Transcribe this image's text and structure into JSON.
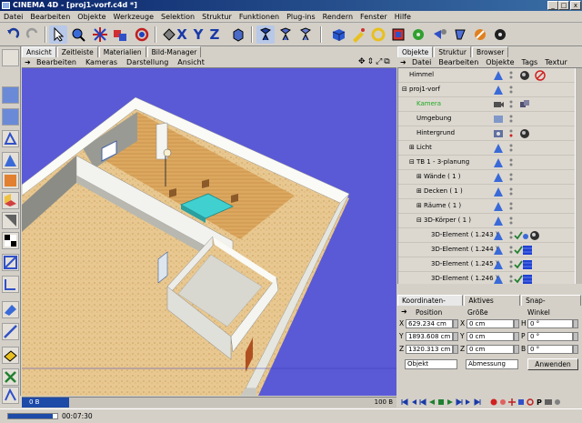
{
  "window": {
    "title": "CINEMA 4D - [proj1-vorf.c4d *]",
    "min": "_",
    "max": "□",
    "close": "x"
  },
  "menu": [
    "Datei",
    "Bearbeiten",
    "Objekte",
    "Werkzeuge",
    "Selektion",
    "Struktur",
    "Funktionen",
    "Plug-ins",
    "Rendern",
    "Fenster",
    "Hilfe"
  ],
  "toolbar": {
    "x": "X",
    "y": "Y",
    "z": "Z"
  },
  "view_tabs": [
    "Ansicht",
    "Zeitleiste",
    "Materialien",
    "Bild-Manager"
  ],
  "view_menu": [
    "Bearbeiten",
    "Kameras",
    "Darstellung",
    "Ansicht"
  ],
  "obj_tabs": [
    "Objekte",
    "Struktur",
    "Browser"
  ],
  "obj_menu": [
    "Datei",
    "Bearbeiten",
    "Objekte",
    "Tags",
    "Textur"
  ],
  "objects": [
    {
      "name": "Himmel",
      "indent": 0,
      "expand": "",
      "color": "#000000"
    },
    {
      "name": "proj1-vorf",
      "indent": 0,
      "expand": "⊟",
      "color": "#000000"
    },
    {
      "name": "Kamera",
      "indent": 1,
      "expand": "",
      "color": "#22aa22"
    },
    {
      "name": "Umgebung",
      "indent": 1,
      "expand": "",
      "color": "#000000"
    },
    {
      "name": "Hintergrund",
      "indent": 1,
      "expand": "",
      "color": "#000000"
    },
    {
      "name": "Licht",
      "indent": 1,
      "expand": "⊞",
      "color": "#000000"
    },
    {
      "name": "TB 1 - 3-planung",
      "indent": 1,
      "expand": "⊟",
      "color": "#000000"
    },
    {
      "name": "Wände ( 1 )",
      "indent": 2,
      "expand": "⊞",
      "color": "#000000"
    },
    {
      "name": "Decken ( 1 )",
      "indent": 2,
      "expand": "⊞",
      "color": "#000000"
    },
    {
      "name": "Räume ( 1 )",
      "indent": 2,
      "expand": "⊞",
      "color": "#000000"
    },
    {
      "name": "3D-Körper ( 1 )",
      "indent": 2,
      "expand": "⊟",
      "color": "#000000"
    },
    {
      "name": "3D-Element ( 1.243 )",
      "indent": 3,
      "expand": "",
      "color": "#000000"
    },
    {
      "name": "3D-Element ( 1.244 )",
      "indent": 3,
      "expand": "",
      "color": "#000000"
    },
    {
      "name": "3D-Element ( 1.245 )",
      "indent": 3,
      "expand": "",
      "color": "#000000"
    },
    {
      "name": "3D-Element ( 1.246 )",
      "indent": 3,
      "expand": "",
      "color": "#000000"
    }
  ],
  "coord_tabs": [
    "Koordinaten-Manager",
    "Aktives Werkzeug",
    "Snap-Einstellungen"
  ],
  "coord": {
    "position_hdr": "Position",
    "size_hdr": "Größe",
    "angle_hdr": "Winkel",
    "rows": [
      {
        "axis": "X",
        "pos": "629.234 cm",
        "size_axis": "X",
        "size": "0 cm",
        "ang_axis": "H",
        "ang": "0 °"
      },
      {
        "axis": "Y",
        "pos": "1893.608 cm",
        "size_axis": "Y",
        "size": "0 cm",
        "ang_axis": "P",
        "ang": "0 °"
      },
      {
        "axis": "Z",
        "pos": "1320.313 cm",
        "size_axis": "Z",
        "size": "0 cm",
        "ang_axis": "B",
        "ang": "0 °"
      }
    ],
    "mode1": "Objekt",
    "mode2": "Abmessung",
    "apply": "Anwenden"
  },
  "timeline": {
    "start": "0 B",
    "end": "100 B",
    "progress": 0.9
  },
  "status": {
    "time": "00:07:30"
  },
  "colors": {
    "viewport": "#5a5ad6",
    "floor": "#e8c890",
    "wall": "#f2f2ee",
    "table": "#40d0d0"
  }
}
